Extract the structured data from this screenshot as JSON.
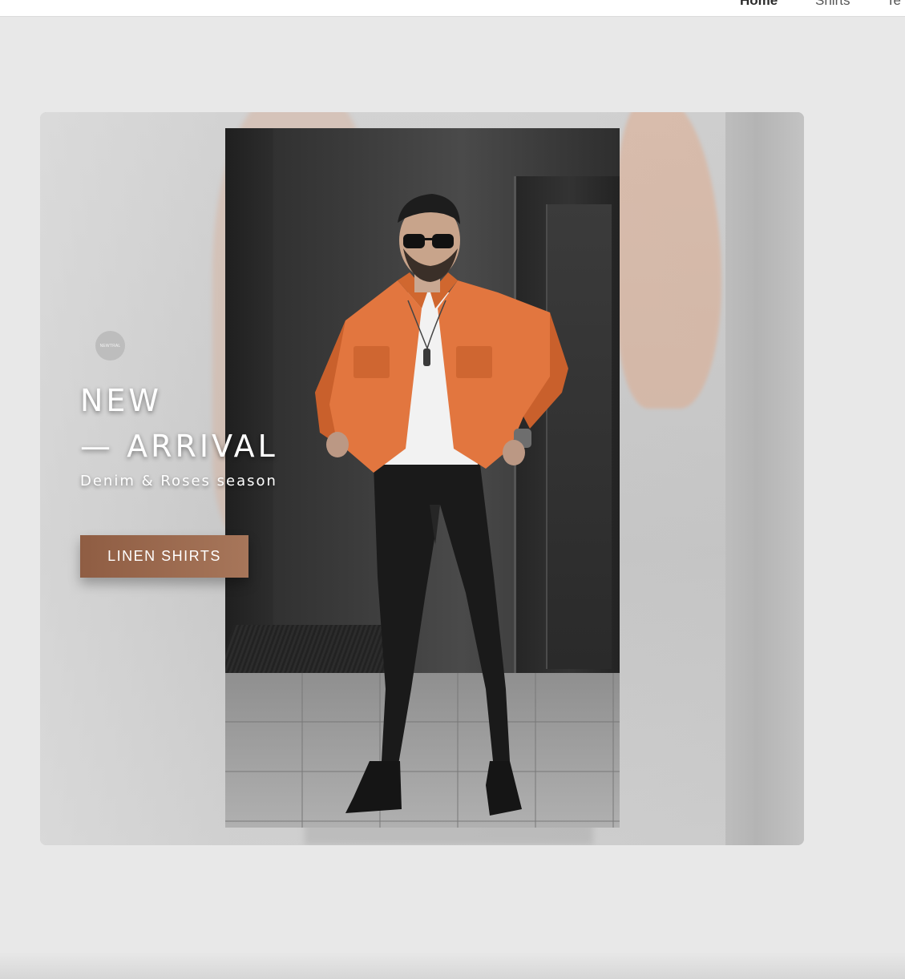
{
  "nav": {
    "items": [
      {
        "label": "Home",
        "active": true
      },
      {
        "label": "Shirts",
        "active": false
      },
      {
        "label": "Te",
        "active": false
      }
    ]
  },
  "hero": {
    "logo_text": "NEWTRAL",
    "headline_line1": "NEW",
    "headline_line2": "— ARRIVAL",
    "subtitle": "Denim & Roses season",
    "cta_label": "LINEN SHIRTS"
  },
  "colors": {
    "page_bg": "#e8e8e8",
    "cta_start": "#8f5d43",
    "cta_end": "#a7765a",
    "jacket": "#e2763f"
  },
  "icons": [
    "brand-logo-icon"
  ]
}
